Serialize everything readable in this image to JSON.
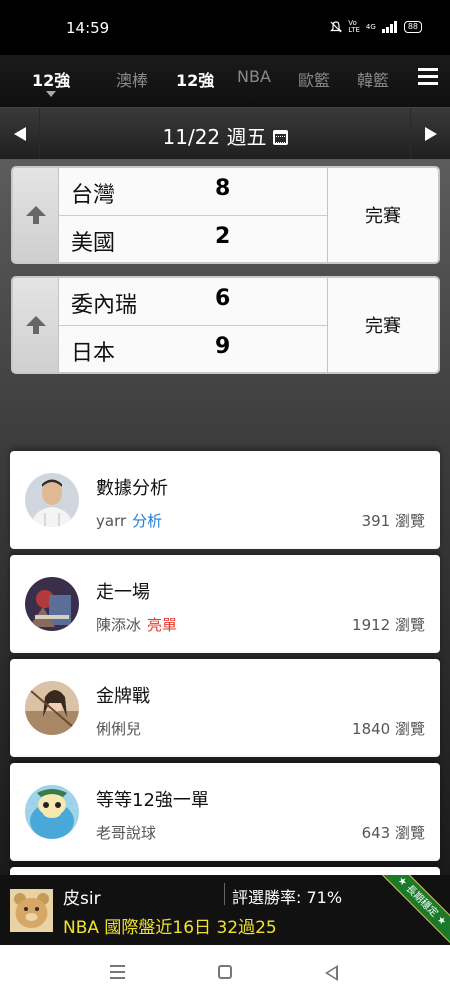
{
  "status": {
    "time": "14:59",
    "icons": [
      "mute-icon",
      "volte-icon",
      "4g-signal-icon",
      "signal-icon"
    ],
    "battery": "88"
  },
  "tabs": {
    "selected": "12強",
    "items": [
      "澳棒",
      "12強",
      "NBA",
      "歐籃",
      "韓籃"
    ]
  },
  "date_bar": {
    "date": "11/22 週五"
  },
  "matches": [
    {
      "home": "台灣",
      "home_score": "8",
      "away": "美國",
      "away_score": "2",
      "status": "完賽"
    },
    {
      "home": "委內瑞",
      "home_score": "6",
      "away": "日本",
      "away_score": "9",
      "status": "完賽"
    }
  ],
  "posts": [
    {
      "title": "數據分析",
      "author": "yarr",
      "tag": "分析",
      "tag_color": "#1e7fd6",
      "views": "391 瀏覽"
    },
    {
      "title": "走一場",
      "author": "陳添冰",
      "tag": "亮單",
      "tag_color": "#e23b2e",
      "views": "1912 瀏覽"
    },
    {
      "title": "金牌戰",
      "author": "俐俐兒",
      "tag": "",
      "tag_color": "",
      "views": "1840 瀏覽"
    },
    {
      "title": "等等12強一單",
      "author": "老哥說球",
      "tag": "",
      "tag_color": "",
      "views": "643 瀏覽"
    }
  ],
  "banner": {
    "name": "皮sir",
    "rate": "評選勝率: 71%",
    "record": "NBA 國際盤近16日 32過25",
    "ribbon": "★ 長期穩定 ★",
    "record_color": "#f0e22a"
  }
}
